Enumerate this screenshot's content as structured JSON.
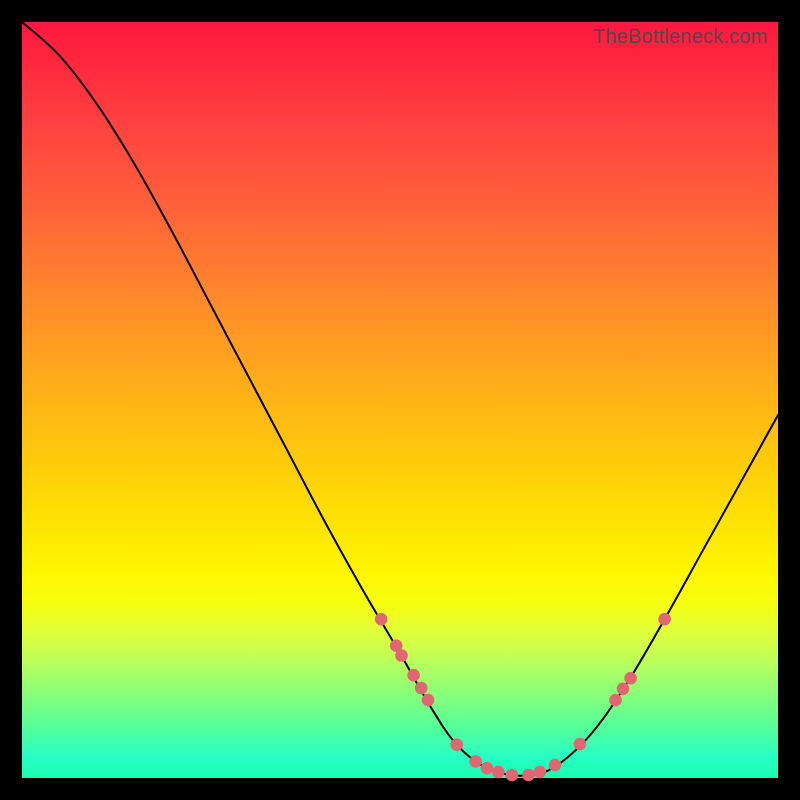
{
  "watermark": "TheBottleneck.com",
  "colors": {
    "background": "#000000",
    "curve": "#000000",
    "dot": "#e06672"
  },
  "chart_data": {
    "type": "line",
    "title": "",
    "xlabel": "",
    "ylabel": "",
    "xlim": [
      0,
      100
    ],
    "ylim": [
      0,
      100
    ],
    "series": [
      {
        "name": "curve",
        "x": [
          0,
          5,
          10,
          15,
          20,
          25,
          30,
          35,
          40,
          45,
          50,
          54,
          57,
          60,
          63,
          66,
          70,
          75,
          80,
          85,
          90,
          95,
          100
        ],
        "y": [
          100,
          95.5,
          89,
          81,
          72,
          62.5,
          53,
          43.5,
          34,
          25,
          16.5,
          9.5,
          5,
          2.2,
          0.8,
          0.3,
          1.2,
          5.5,
          12.5,
          21,
          30,
          39,
          48
        ]
      }
    ],
    "markers": [
      {
        "x": 47.5,
        "y": 21.0
      },
      {
        "x": 49.5,
        "y": 17.5
      },
      {
        "x": 50.2,
        "y": 16.2
      },
      {
        "x": 51.8,
        "y": 13.6
      },
      {
        "x": 52.8,
        "y": 11.9
      },
      {
        "x": 53.7,
        "y": 10.3
      },
      {
        "x": 57.5,
        "y": 4.4
      },
      {
        "x": 60.0,
        "y": 2.2
      },
      {
        "x": 61.5,
        "y": 1.3
      },
      {
        "x": 63.0,
        "y": 0.8
      },
      {
        "x": 64.8,
        "y": 0.4
      },
      {
        "x": 67.0,
        "y": 0.4
      },
      {
        "x": 68.5,
        "y": 0.8
      },
      {
        "x": 70.5,
        "y": 1.7
      },
      {
        "x": 73.8,
        "y": 4.5
      },
      {
        "x": 78.5,
        "y": 10.3
      },
      {
        "x": 79.5,
        "y": 11.8
      },
      {
        "x": 80.5,
        "y": 13.2
      },
      {
        "x": 85.0,
        "y": 21.0
      }
    ]
  }
}
